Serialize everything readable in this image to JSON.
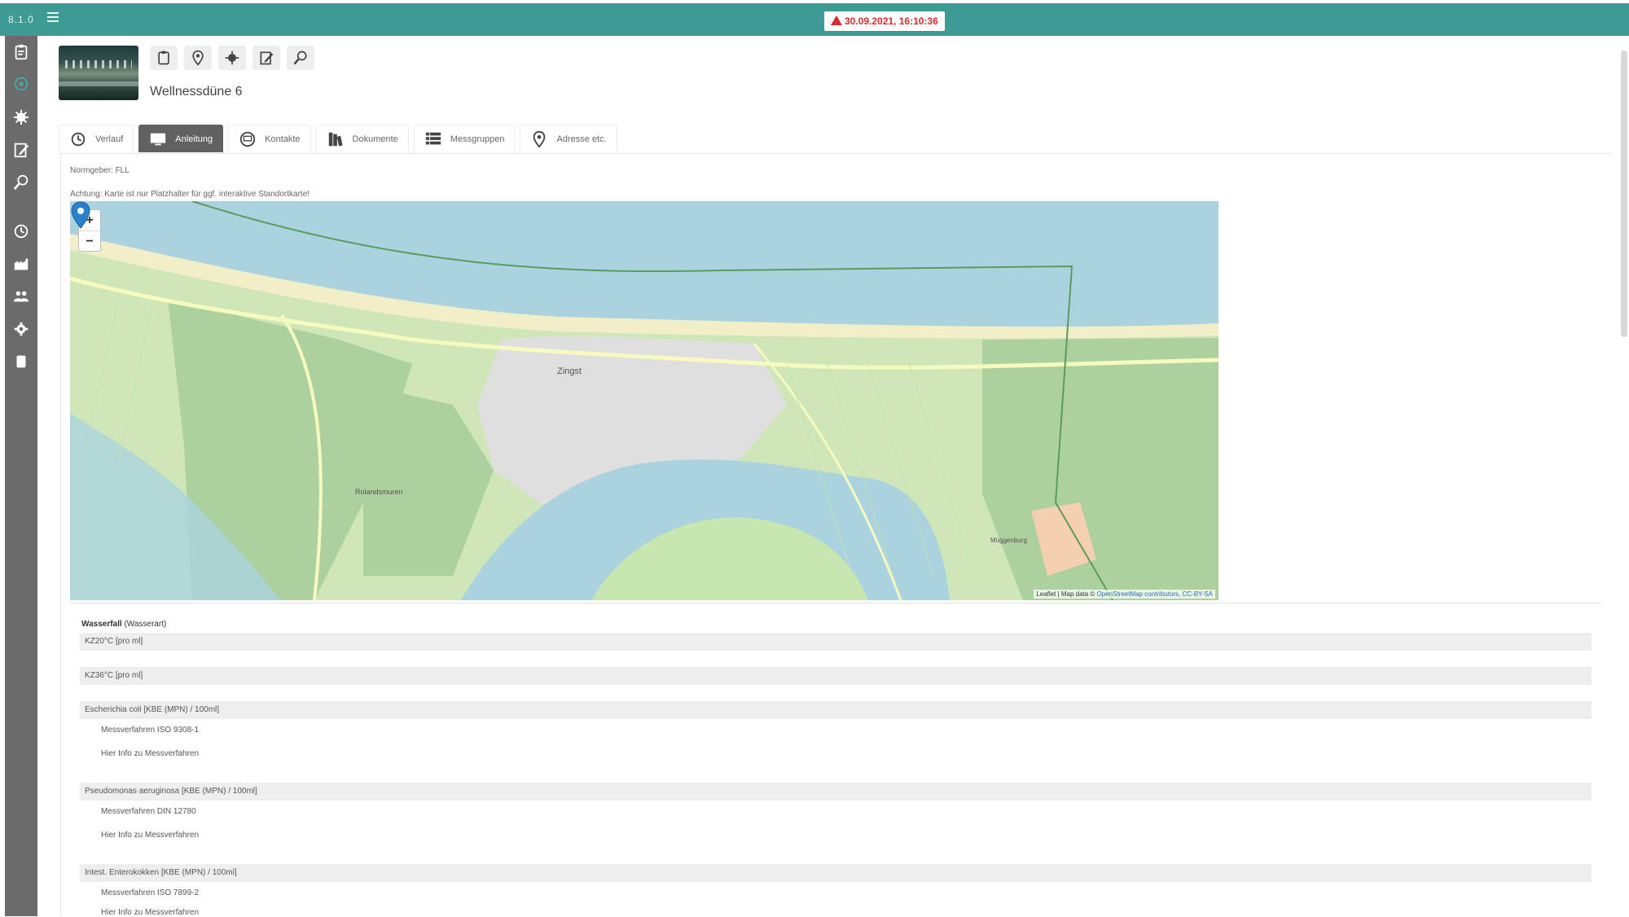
{
  "app": {
    "version": "8.1.0",
    "menu_icon": "hamburger-icon"
  },
  "alert": {
    "text": "30.09.2021, 16:10:36",
    "color": "#d42d2d",
    "icon": "warning-triangle-icon"
  },
  "colors": {
    "topbar": "#3d9b93",
    "sidebar": "#6b6b6b",
    "active_tab": "#616161"
  },
  "sidebar": {
    "items": [
      {
        "icon": "clipboard-icon",
        "active": false
      },
      {
        "icon": "map-pin-icon",
        "active": true
      },
      {
        "icon": "virus-icon",
        "active": false
      },
      {
        "icon": "edit-note-icon",
        "active": false
      },
      {
        "icon": "search-list-icon",
        "active": false
      },
      {
        "icon": "history-icon",
        "active": false
      },
      {
        "icon": "factory-icon",
        "active": false
      },
      {
        "icon": "users-icon",
        "active": false
      },
      {
        "icon": "gear-icon",
        "active": false
      },
      {
        "icon": "database-icon",
        "active": false
      }
    ]
  },
  "header": {
    "title": "Wellnessdüne 6",
    "tools": [
      "clipboard-icon",
      "map-pin-icon",
      "virus-icon",
      "edit-note-icon",
      "search-list-icon"
    ]
  },
  "tabs": [
    {
      "label": "Verlauf",
      "icon": "history-icon",
      "active": false
    },
    {
      "label": "Anleitung",
      "icon": "screen-icon",
      "active": true
    },
    {
      "label": "Kontakte",
      "icon": "contact-icon",
      "active": false
    },
    {
      "label": "Dokumente",
      "icon": "books-icon",
      "active": false
    },
    {
      "label": "Messgruppen",
      "icon": "table-list-icon",
      "active": false
    },
    {
      "label": "Adresse etc.",
      "icon": "map-pin-icon",
      "active": false
    }
  ],
  "content": {
    "normgeber": "Normgeber: FLL",
    "map_note": "Achtung: Karte ist nur Platzhalter für ggf. interaktive Standortkarte!"
  },
  "map": {
    "zoom_in": "+",
    "zoom_out": "−",
    "place_labels": {
      "town": "Zingst",
      "town2": "Rolandsmuren",
      "east": "Müggenburg"
    },
    "attribution_prefix": "Leaflet | Map data ©",
    "attribution_link": "OpenStreetMap contributors, CC-BY-SA"
  },
  "parameters": {
    "title_bold": "Wasserfall",
    "title_rest": "(Wasserart)",
    "rows": [
      {
        "label": "KZ20°C [pro ml]",
        "method": "",
        "info": ""
      },
      {
        "label": "KZ36°C [pro ml]",
        "method": "",
        "info": ""
      },
      {
        "label": "Escherichia coli [KBE (MPN) / 100ml]",
        "method": "Messverfahren ISO 9308-1",
        "info": "Hier Info zu Messverfahren"
      },
      {
        "label": "Pseudomonas aeruginosa [KBE (MPN) / 100ml]",
        "method": "Messverfahren DIN 12780",
        "info": "Hier Info zu Messverfahren"
      },
      {
        "label": "Intest. Enterokokken [KBE (MPN) / 100ml]",
        "method": "Messverfahren ISO 7899-2",
        "info": "Hier Info zu Messverfahren"
      }
    ]
  }
}
